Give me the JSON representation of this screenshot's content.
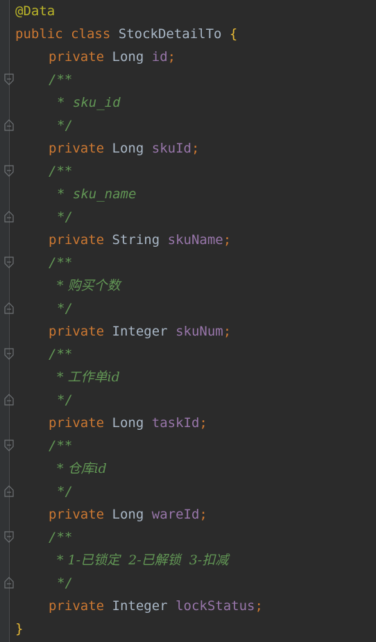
{
  "code": {
    "annotation": "@Data",
    "class_decl": {
      "kw1": "public",
      "kw2": "class",
      "name": "StockDetailTo",
      "brace": "{"
    },
    "fields": [
      {
        "kw": "private",
        "type": "Long",
        "name": "id",
        "semi": ";"
      },
      {
        "kw": "private",
        "type": "Long",
        "name": "skuId",
        "semi": ";"
      },
      {
        "kw": "private",
        "type": "String",
        "name": "skuName",
        "semi": ";"
      },
      {
        "kw": "private",
        "type": "Integer",
        "name": "skuNum",
        "semi": ";"
      },
      {
        "kw": "private",
        "type": "Long",
        "name": "taskId",
        "semi": ";"
      },
      {
        "kw": "private",
        "type": "Long",
        "name": "wareId",
        "semi": ";"
      },
      {
        "kw": "private",
        "type": "Integer",
        "name": "lockStatus",
        "semi": ";"
      }
    ],
    "comments": [
      {
        "open": "/**",
        "body": "* sku_id",
        "close": "*/"
      },
      {
        "open": "/**",
        "body": "* sku_name",
        "close": "*/"
      },
      {
        "open": "/**",
        "body": "* 购买个数",
        "close": "*/"
      },
      {
        "open": "/**",
        "body": "* 工作单id",
        "close": "*/"
      },
      {
        "open": "/**",
        "body": "* 仓库id",
        "close": "*/"
      },
      {
        "open": "/**",
        "body": "* 1-已锁定  2-已解锁  3-扣减",
        "close": "*/"
      }
    ],
    "closing_brace": "}"
  },
  "colors": {
    "background": "#2b2b2b",
    "keyword": "#cc7832",
    "annotation": "#bbb529",
    "field": "#9876aa",
    "comment": "#629755",
    "text": "#a9b7c6"
  },
  "icons": {
    "fold_open": "fold-open-icon",
    "fold_close": "fold-close-icon"
  }
}
